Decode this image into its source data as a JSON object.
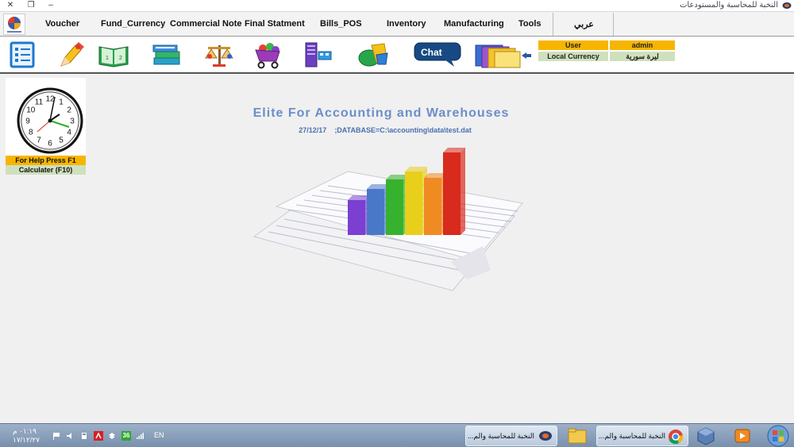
{
  "window": {
    "title": "النخبة للمحاسبة والمستودعات",
    "close_glyph": "✕",
    "restore_glyph": "❐",
    "minimize_glyph": "–"
  },
  "menu": {
    "items": [
      "Voucher",
      "Fund_Currency",
      "Commercial Note",
      "Final Statment",
      "Bills_POS",
      "Inventory",
      "Manufacturing",
      "Tools",
      "عربي"
    ]
  },
  "toolbar": {
    "icons": [
      "checklist-icon",
      "pencil-icon",
      "book-icon",
      "books-stack-icon",
      "balance-scale-icon",
      "shopping-cart-icon",
      "server-icon",
      "shapes-icon",
      "chat-icon",
      "folders-icon"
    ],
    "chat_label": "Chat"
  },
  "info_panel": {
    "user_label": "User",
    "user_value": "admin",
    "currency_label": "Local Currency",
    "currency_value": "ليرة سورية"
  },
  "clock_panel": {
    "help_text": "For Help Press F1",
    "calculator_text": "Calculater (F10)",
    "numbers": [
      "12",
      "1",
      "2",
      "3",
      "4",
      "5",
      "6",
      "7",
      "8",
      "9",
      "10",
      "11"
    ]
  },
  "main": {
    "title": "Elite For Accounting and Warehouses",
    "date": "27/12/17",
    "database": ";DATABASE=C:\\accounting\\data\\test.dat"
  },
  "taskbar": {
    "time": "٠١:١٩ م",
    "date": "١٧/١٢/٢٧",
    "badge": "36",
    "language": "EN",
    "buttons": [
      "النخبة للمحاسبة والم...",
      "النخبة للمحاسبة والم..."
    ]
  },
  "colors": {
    "accent_title": "#6a8fc9",
    "info_label_bg": "#f7b500",
    "info_value_bg": "#cfe0bd",
    "bar_colors": [
      "#7b3fd1",
      "#4a78c8",
      "#37b22e",
      "#e8cf1c",
      "#f08a22",
      "#d82a1d"
    ]
  }
}
